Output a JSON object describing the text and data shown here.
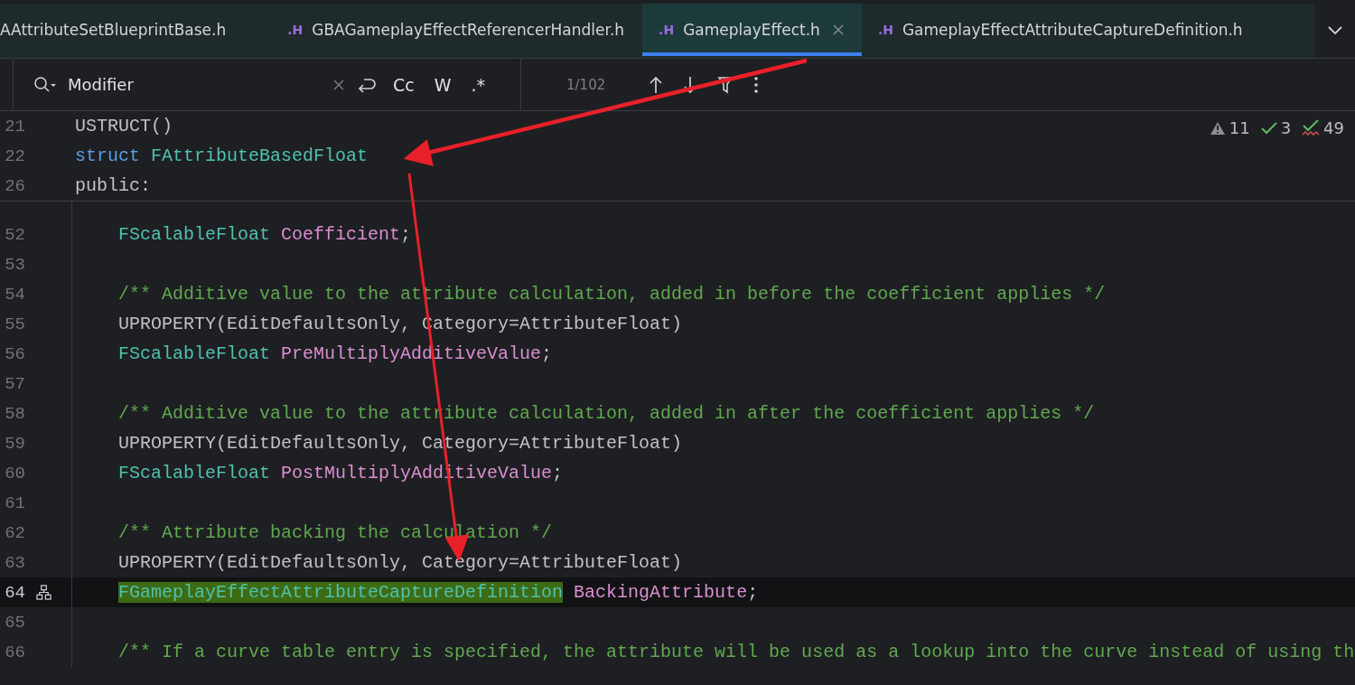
{
  "tabs": [
    {
      "label": "AAttributeSetBlueprintBase.h",
      "selected": false,
      "closable": false
    },
    {
      "label": "GBAGameplayEffectReferencerHandler.h",
      "badge": ".H",
      "selected": false,
      "closable": false
    },
    {
      "label": "GameplayEffect.h",
      "badge": ".H",
      "selected": true,
      "closable": true
    },
    {
      "label": "GameplayEffectAttributeCaptureDefinition.h",
      "badge": ".H",
      "selected": false,
      "closable": false
    }
  ],
  "search": {
    "value": "Modifier",
    "toggles": [
      "Cc",
      "W",
      ".*"
    ],
    "count": "1/102"
  },
  "inspections": [
    {
      "kind": "warning",
      "count": "11"
    },
    {
      "kind": "ok",
      "count": "3"
    },
    {
      "kind": "typo",
      "count": "49"
    }
  ],
  "sticky_lines": [
    {
      "number": "21",
      "tokens": [
        {
          "kind": "plain",
          "text": "USTRUCT()"
        }
      ]
    },
    {
      "number": "22",
      "tokens": [
        {
          "kind": "keyword",
          "text": "struct"
        },
        {
          "kind": "type",
          "text": " FAttributeBasedFloat"
        }
      ]
    },
    {
      "number": "26",
      "tokens": [
        {
          "kind": "plain",
          "text": "public:"
        }
      ]
    }
  ],
  "lines": [
    {
      "number": "52",
      "current": false,
      "tokens": [
        {
          "kind": "type",
          "text": "FScalableFloat"
        },
        {
          "kind": "field",
          "text": " Coefficient"
        },
        {
          "kind": "plain",
          "text": ";"
        }
      ]
    },
    {
      "number": "53",
      "current": false
    },
    {
      "number": "54",
      "current": false,
      "tokens": [
        {
          "kind": "comment",
          "text": "/** Additive value to the attribute calculation, added in before the coefficient applies */"
        }
      ]
    },
    {
      "number": "55",
      "current": false,
      "tokens": [
        {
          "kind": "plain",
          "text": "UPROPERTY(EditDefaultsOnly, Category=AttributeFloat)"
        }
      ]
    },
    {
      "number": "56",
      "current": false,
      "tokens": [
        {
          "kind": "type",
          "text": "FScalableFloat"
        },
        {
          "kind": "field",
          "text": " PreMultiplyAdditiveValue"
        },
        {
          "kind": "plain",
          "text": ";"
        }
      ]
    },
    {
      "number": "57",
      "current": false
    },
    {
      "number": "58",
      "current": false,
      "tokens": [
        {
          "kind": "comment",
          "text": "/** Additive value to the attribute calculation, added in after the coefficient applies */"
        }
      ]
    },
    {
      "number": "59",
      "current": false,
      "tokens": [
        {
          "kind": "plain",
          "text": "UPROPERTY(EditDefaultsOnly, Category=AttributeFloat)"
        }
      ]
    },
    {
      "number": "60",
      "current": false,
      "tokens": [
        {
          "kind": "type",
          "text": "FScalableFloat"
        },
        {
          "kind": "field",
          "text": " PostMultiplyAdditiveValue"
        },
        {
          "kind": "plain",
          "text": ";"
        }
      ]
    },
    {
      "number": "61",
      "current": false
    },
    {
      "number": "62",
      "current": false,
      "tokens": [
        {
          "kind": "comment",
          "text": "/** Attribute backing the calculation */"
        }
      ]
    },
    {
      "number": "63",
      "current": false,
      "tokens": [
        {
          "kind": "plain",
          "text": "UPROPERTY(EditDefaultsOnly, Category=AttributeFloat)"
        }
      ]
    },
    {
      "number": "64",
      "current": true,
      "gutter_icon": true,
      "tokens": [
        {
          "kind": "type",
          "text": "FGameplayEffectAttributeCaptureDefinition",
          "highlighted": true
        },
        {
          "kind": "field",
          "text": " BackingAttribute"
        },
        {
          "kind": "plain",
          "text": ";"
        }
      ]
    },
    {
      "number": "65",
      "current": false
    },
    {
      "number": "66",
      "current": false,
      "tokens": [
        {
          "kind": "comment",
          "text": "/** If a curve table entry is specified, the attribute will be used as a lookup into the curve instead of using th"
        }
      ]
    }
  ]
}
